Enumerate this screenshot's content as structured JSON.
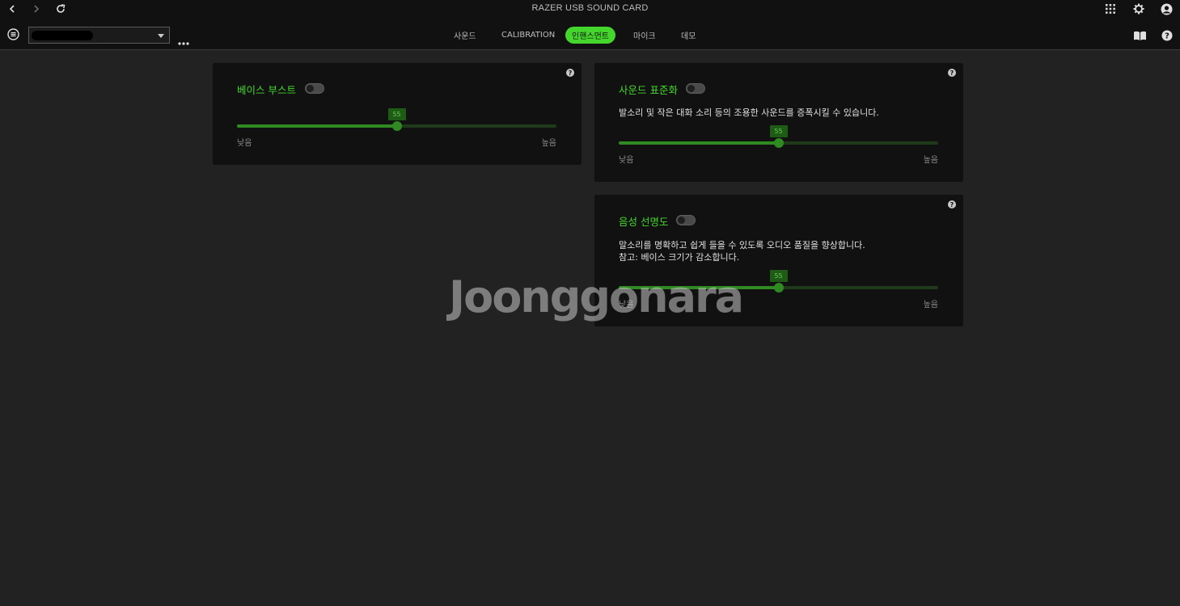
{
  "window": {
    "title": "RAZER USB SOUND CARD"
  },
  "nav": {
    "back_icon": "chevron-left-icon",
    "forward_icon": "chevron-right-icon",
    "refresh_icon": "refresh-icon"
  },
  "top_right_icons": [
    "apps-grid-icon",
    "gear-icon",
    "profile-icon"
  ],
  "toolbar": {
    "tabs": [
      {
        "label": "사운드",
        "active": false
      },
      {
        "label": "CALIBRATION",
        "active": false
      },
      {
        "label": "인핸스먼트",
        "active": true
      },
      {
        "label": "마이크",
        "active": false
      },
      {
        "label": "데모",
        "active": false
      }
    ],
    "right_icons": [
      "book-icon",
      "help-icon"
    ]
  },
  "colors": {
    "accent": "#44d62c",
    "slider_fill": "#2f8a22",
    "background": "#222222",
    "panel": "#111111"
  },
  "cards": [
    {
      "id": "bass-boost",
      "title": "베이스 부스트",
      "enabled": false,
      "description": [],
      "value": "55",
      "level": 0.5,
      "low_label": "낮음",
      "high_label": "높음"
    },
    {
      "id": "sound-normalization",
      "title": "사운드 표준화",
      "enabled": false,
      "description": [
        "발소리 및 작은 대화 소리 등의 조용한 사운드를 증폭시킬 수 있습니다."
      ],
      "value": "55",
      "level": 0.5,
      "low_label": "낮음",
      "high_label": "높음"
    },
    {
      "id": "voice-clarity",
      "title": "음성 선명도",
      "enabled": false,
      "description": [
        "말소리를 명확하고 쉽게 들을 수 있도록 오디오 품질을 향상합니다.",
        "참고: 베이스 크기가 감소합니다."
      ],
      "value": "55",
      "level": 0.5,
      "low_label": "낮음",
      "high_label": "높음"
    }
  ],
  "watermark": "Joonggonara"
}
